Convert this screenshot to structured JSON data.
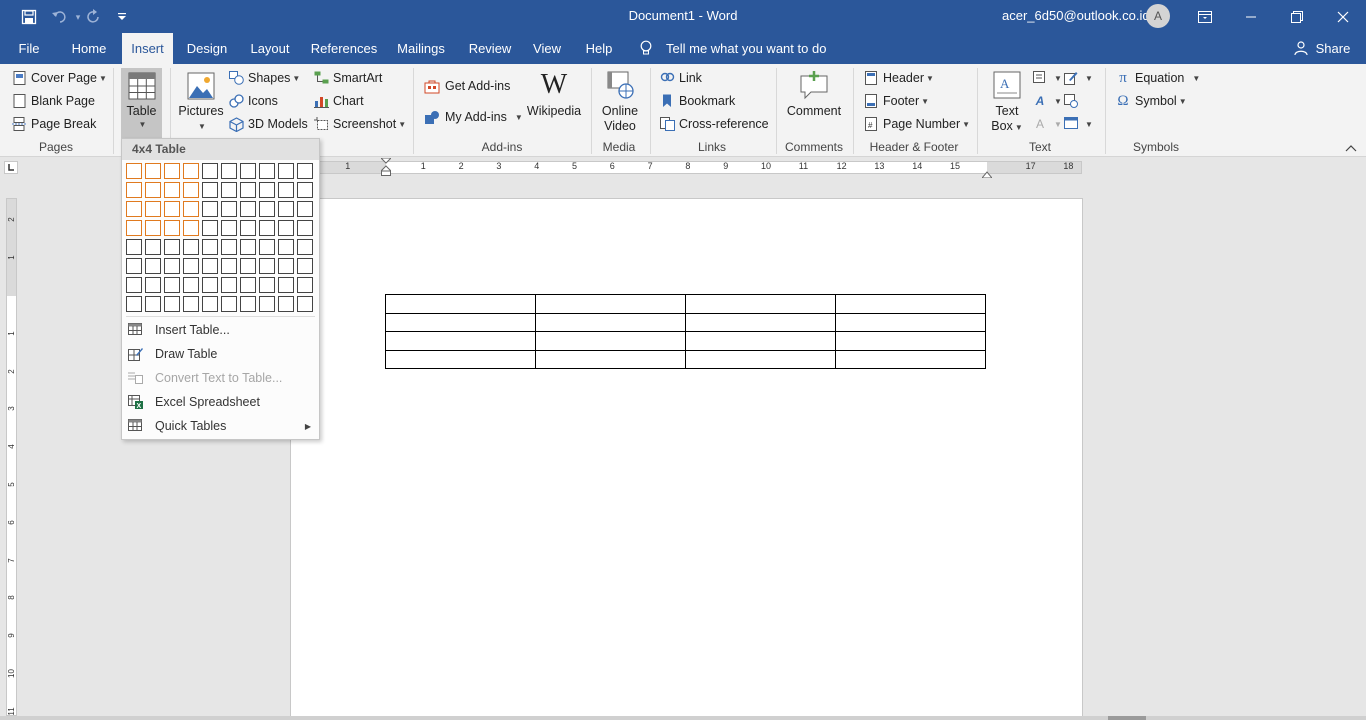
{
  "titlebar": {
    "document_title": "Document1 - Word",
    "account": "acer_6d50@outlook.co.id",
    "avatar_initial": "A",
    "save_icon": "save-icon",
    "undo_icon": "undo-icon",
    "redo_icon": "redo-icon",
    "customize_icon": "customize-quick-access-icon",
    "ribbon_display_icon": "ribbon-display-options-icon",
    "minimize_icon": "minimize-icon",
    "restore_icon": "restore-icon",
    "close_icon": "close-icon"
  },
  "tabs": {
    "file": "File",
    "home": "Home",
    "insert": "Insert",
    "design": "Design",
    "layout": "Layout",
    "references": "References",
    "mailings": "Mailings",
    "review": "Review",
    "view": "View",
    "help": "Help",
    "tell_me": "Tell me what you want to do",
    "share": "Share"
  },
  "ribbon": {
    "pages": {
      "cover_page": "Cover Page",
      "blank_page": "Blank Page",
      "page_break": "Page Break",
      "group": "Pages"
    },
    "tables": {
      "table": "Table"
    },
    "illustrations": {
      "pictures": "Pictures",
      "shapes": "Shapes",
      "icons": "Icons",
      "models": "3D Models",
      "smartart": "SmartArt",
      "chart": "Chart",
      "screenshot": "Screenshot"
    },
    "addins": {
      "get_addins": "Get Add-ins",
      "my_addins": "My Add-ins",
      "wikipedia": "Wikipedia",
      "group": "Add-ins"
    },
    "media": {
      "online_video_1": "Online",
      "online_video_2": "Video",
      "group": "Media"
    },
    "links": {
      "link": "Link",
      "bookmark": "Bookmark",
      "cross_reference": "Cross-reference",
      "group": "Links"
    },
    "comments": {
      "comment": "Comment",
      "group": "Comments"
    },
    "header_footer": {
      "header": "Header",
      "footer": "Footer",
      "page_number": "Page Number",
      "group": "Header & Footer"
    },
    "text": {
      "text_box_1": "Text",
      "text_box_2": "Box",
      "group": "Text"
    },
    "symbols": {
      "equation": "Equation",
      "symbol": "Symbol",
      "group": "Symbols"
    },
    "collapse_icon": "collapse-ribbon-icon"
  },
  "table_menu": {
    "grid_title": "4x4 Table",
    "grid_rows": 8,
    "grid_cols": 10,
    "selected_rows": 4,
    "selected_cols": 4,
    "items": [
      {
        "label": "Insert Table...",
        "icon": "insert-table-icon",
        "enabled": true
      },
      {
        "label": "Draw Table",
        "icon": "draw-table-icon",
        "enabled": true
      },
      {
        "label": "Convert Text to Table...",
        "icon": "convert-text-to-table-icon",
        "enabled": false
      },
      {
        "label": "Excel Spreadsheet",
        "icon": "excel-spreadsheet-icon",
        "enabled": true
      },
      {
        "label": "Quick Tables",
        "icon": "quick-tables-icon",
        "enabled": true
      }
    ]
  },
  "ruler": {
    "tab_selector_icon": "tab-selector-icon",
    "h_numbers": [
      "1",
      "1",
      "2",
      "3",
      "4",
      "5",
      "6",
      "7",
      "8",
      "9",
      "10",
      "11",
      "12",
      "13",
      "14",
      "15",
      "17",
      "18"
    ],
    "v_numbers": [
      "2",
      "1",
      "1",
      "2",
      "3",
      "4",
      "5",
      "6",
      "7",
      "8",
      "9",
      "10",
      "11"
    ]
  },
  "document": {
    "table_rows": 4,
    "table_cols": 4
  },
  "colors": {
    "word_blue": "#2b579a",
    "ribbon_bg": "#f3f3f3",
    "grid_selected": "#e07a1f"
  }
}
